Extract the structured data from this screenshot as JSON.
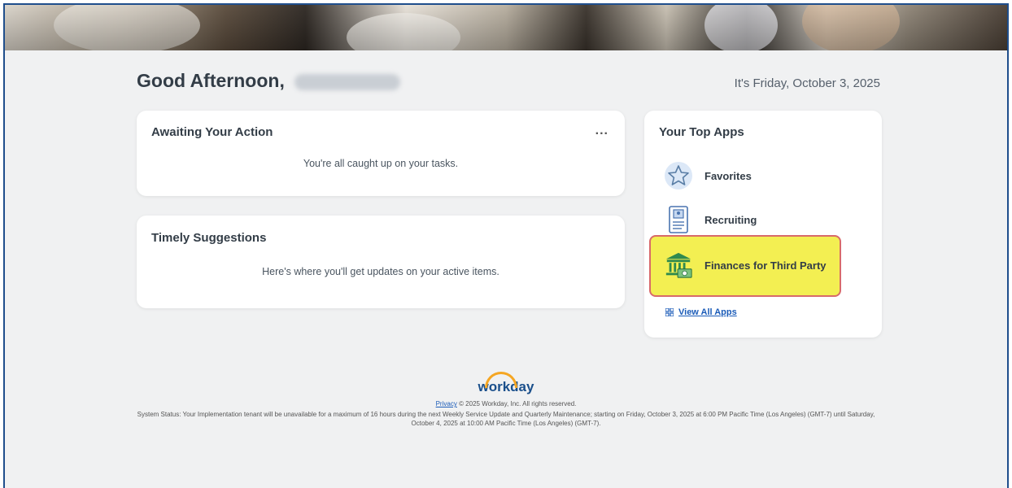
{
  "header": {
    "greeting": "Good Afternoon,",
    "date": "It's Friday, October 3, 2025"
  },
  "awaiting": {
    "title": "Awaiting Your Action",
    "more": "...",
    "message": "You're all caught up on your tasks."
  },
  "suggestions": {
    "title": "Timely Suggestions",
    "message": "Here's where you'll get updates on your active items."
  },
  "top_apps": {
    "title": "Your Top Apps",
    "items": [
      {
        "label": "Favorites",
        "icon": "star-icon"
      },
      {
        "label": "Recruiting",
        "icon": "document-icon"
      },
      {
        "label": "Finances for Third Party",
        "icon": "bank-icon"
      }
    ],
    "view_all": "View All Apps"
  },
  "footer": {
    "logo": "workday",
    "privacy": "Privacy",
    "copyright": "© 2025 Workday, Inc. All rights reserved.",
    "status": "System Status: Your Implementation tenant will be unavailable for a maximum of 16 hours during the next Weekly Service Update and Quarterly Maintenance; starting on Friday, October 3, 2025 at 6:00 PM Pacific Time (Los Angeles) (GMT-7) until Saturday, October 4, 2025 at 10:00 AM Pacific Time (Los Angeles) (GMT-7)."
  },
  "colors": {
    "highlight": "#f3ef52",
    "highlight_border": "#d86a6a",
    "link": "#1a5bb8",
    "logo_arc": "#f5a623"
  }
}
